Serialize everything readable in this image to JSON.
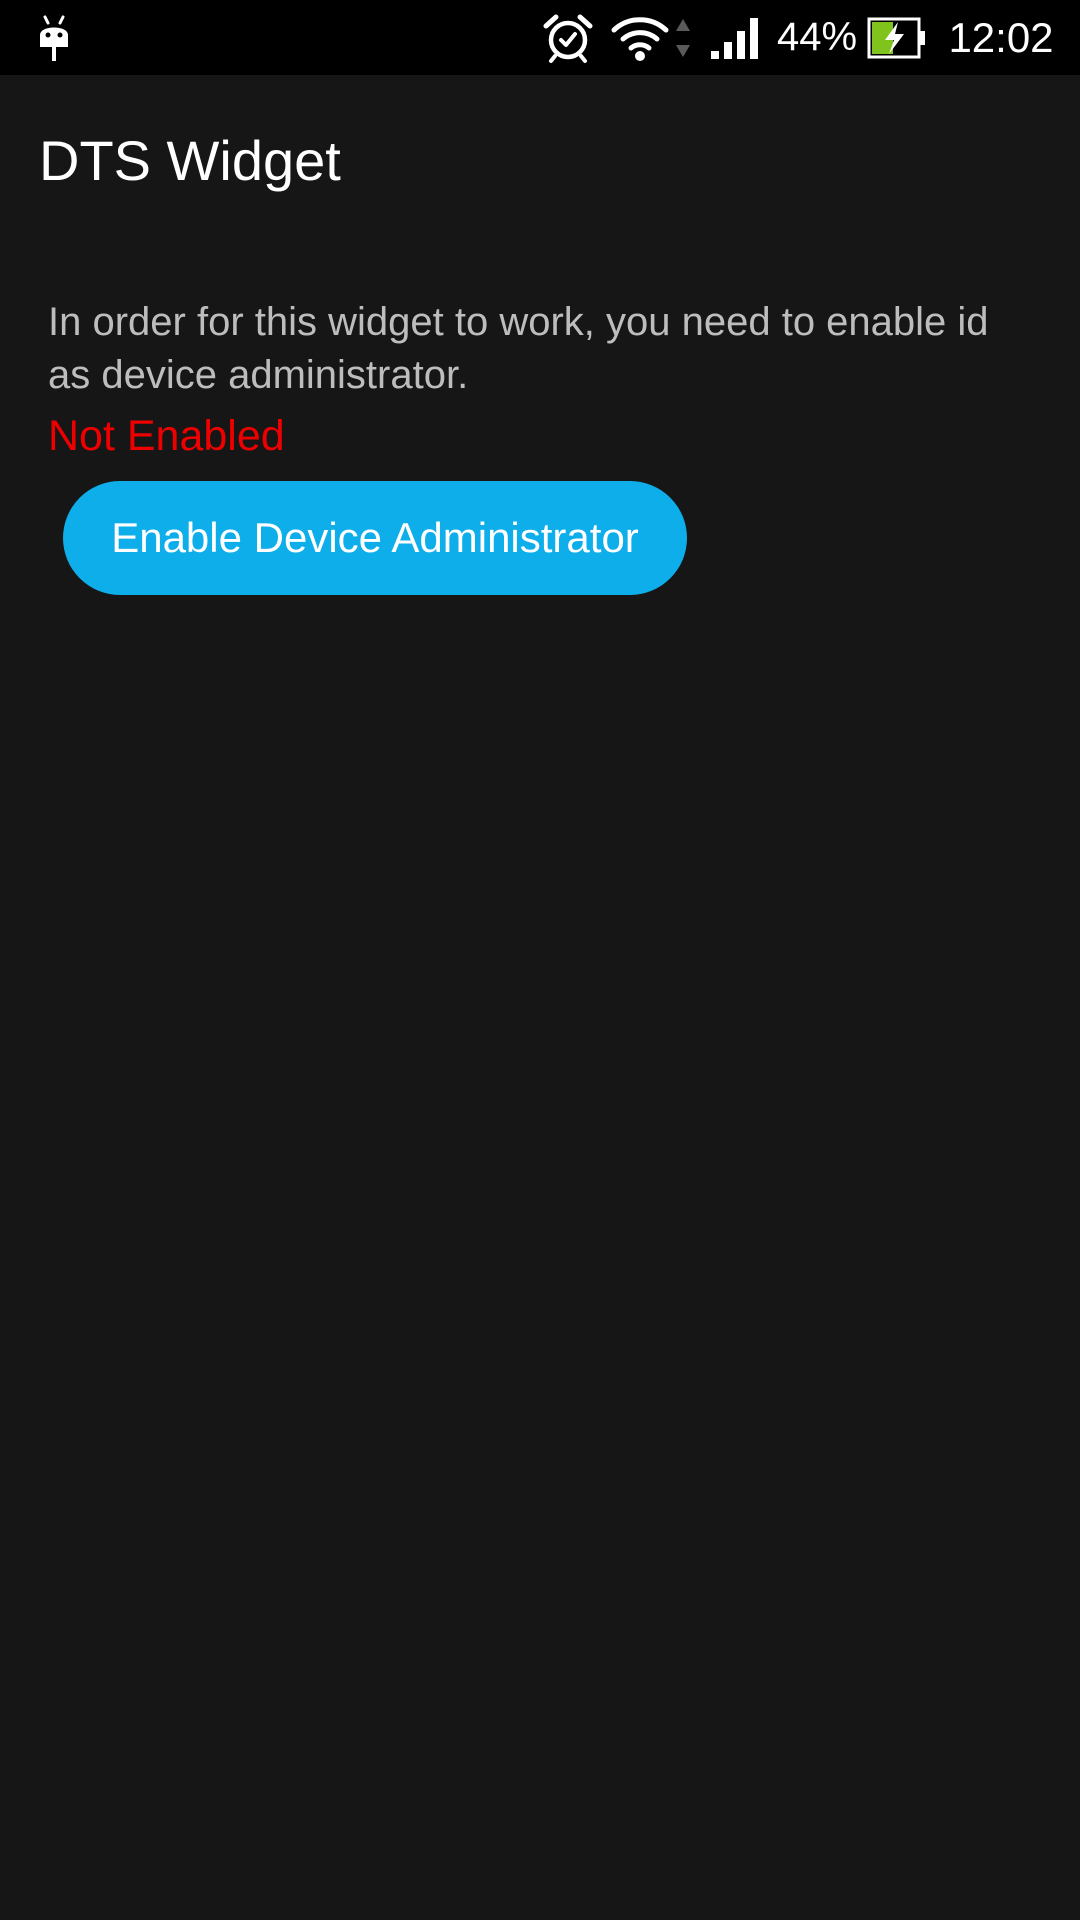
{
  "status_bar": {
    "left_icon": "android-debug-icon",
    "icons": [
      "alarm-icon",
      "wifi-icon",
      "data-activity-icon",
      "signal-icon",
      "battery-charging-icon"
    ],
    "battery_percent": "44%",
    "battery_level": 0.44,
    "time": "12:02"
  },
  "app_bar": {
    "title": "DTS Widget"
  },
  "content": {
    "description": "In order for this widget to work, you need to enable id as device administrator.",
    "status": "Not Enabled",
    "enable_button_label": "Enable Device Administrator"
  },
  "colors": {
    "background": "#161616",
    "status_bar": "#000000",
    "status_not_enabled": "#ee0000",
    "button": "#0eaeea",
    "battery_fill": "#7fc31c"
  }
}
